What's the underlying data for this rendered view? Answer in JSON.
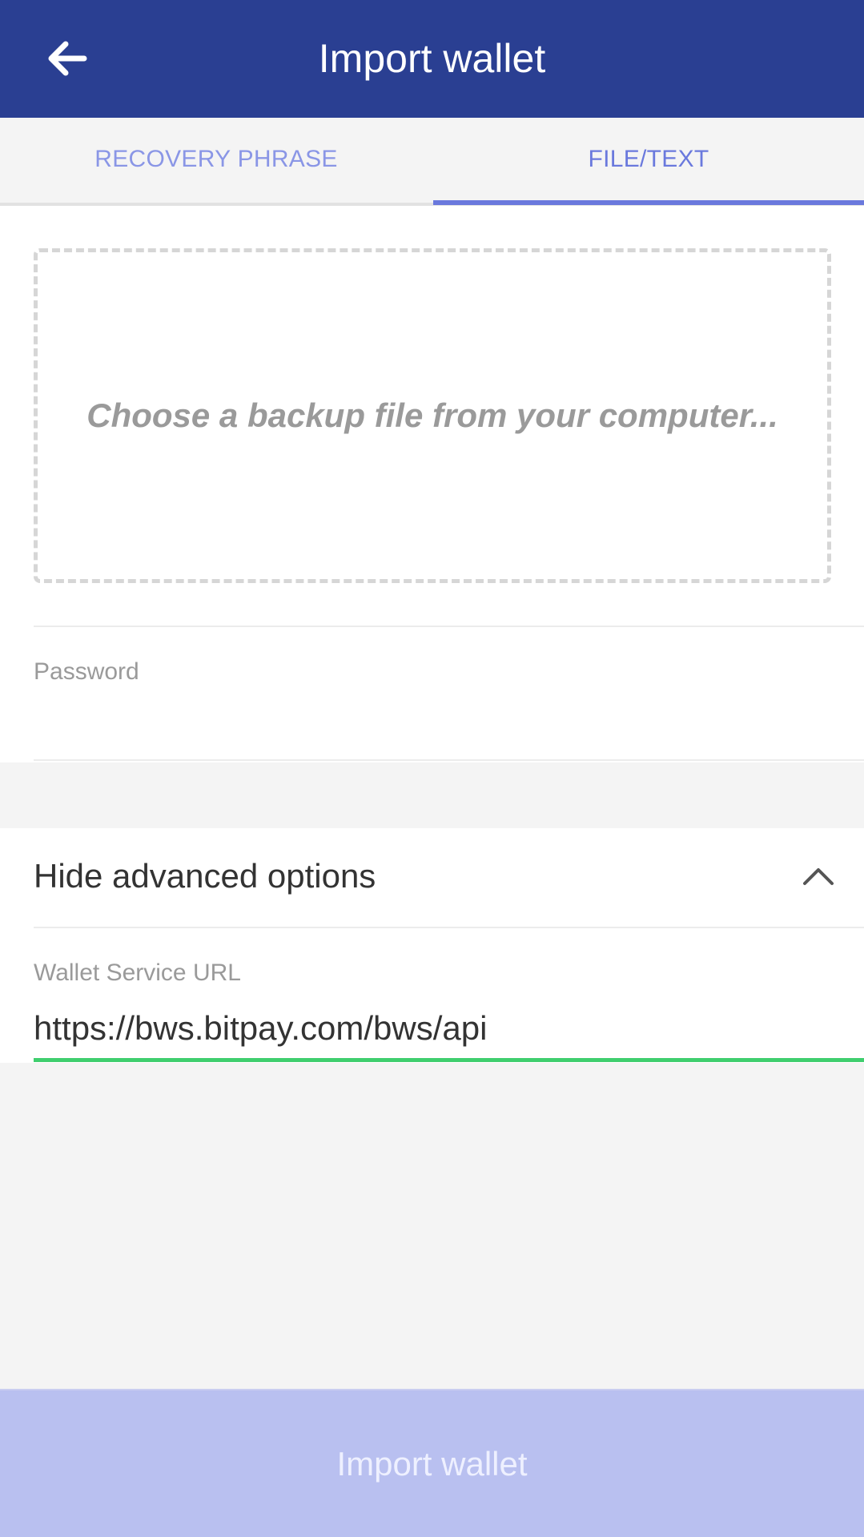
{
  "header": {
    "title": "Import wallet",
    "back_icon": "arrow-left-icon"
  },
  "tabs": [
    {
      "label": "RECOVERY PHRASE",
      "active": false
    },
    {
      "label": "FILE/TEXT",
      "active": true
    }
  ],
  "file_section": {
    "dropzone_text": "Choose a backup file from your computer...",
    "password_label": "Password",
    "password_value": ""
  },
  "advanced": {
    "toggle_label": "Hide advanced options",
    "toggle_icon": "chevron-up-icon",
    "wallet_service_label": "Wallet Service URL",
    "wallet_service_value": "https://bws.bitpay.com/bws/api"
  },
  "footer": {
    "import_button_label": "Import wallet"
  },
  "colors": {
    "header_bg": "#2a3f92",
    "tab_active": "#6a79dd",
    "tab_inactive": "#8a96e6",
    "focus_underline": "#3fce6e",
    "button_bg": "#b9c0f0"
  }
}
